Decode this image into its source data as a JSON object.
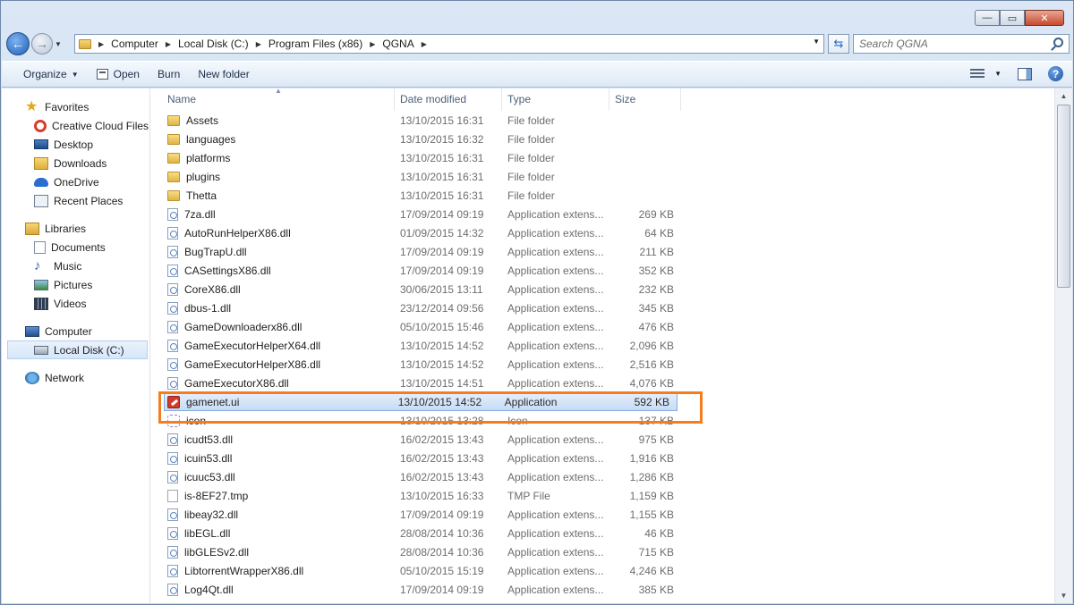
{
  "window": {
    "buttons": {
      "minimize": "—",
      "maximize": "▭",
      "close": "✕"
    }
  },
  "navigation": {
    "breadcrumb": [
      "Computer",
      "Local Disk (C:)",
      "Program Files (x86)",
      "QGNA"
    ],
    "search_placeholder": "Search QGNA"
  },
  "toolbar": {
    "organize": "Organize",
    "open": "Open",
    "burn": "Burn",
    "new_folder": "New folder"
  },
  "navpane": {
    "favorites": "Favorites",
    "creative_cloud": "Creative Cloud Files",
    "desktop": "Desktop",
    "downloads": "Downloads",
    "onedrive": "OneDrive",
    "recent": "Recent Places",
    "libraries": "Libraries",
    "documents": "Documents",
    "music": "Music",
    "pictures": "Pictures",
    "videos": "Videos",
    "computer": "Computer",
    "local_disk": "Local Disk (C:)",
    "network": "Network"
  },
  "columns": {
    "name": "Name",
    "date": "Date modified",
    "type": "Type",
    "size": "Size"
  },
  "files": [
    {
      "name": "Assets",
      "date": "13/10/2015 16:31",
      "type": "File folder",
      "size": "",
      "icon": "folder-icon"
    },
    {
      "name": "languages",
      "date": "13/10/2015 16:32",
      "type": "File folder",
      "size": "",
      "icon": "folder-icon"
    },
    {
      "name": "platforms",
      "date": "13/10/2015 16:31",
      "type": "File folder",
      "size": "",
      "icon": "folder-icon"
    },
    {
      "name": "plugins",
      "date": "13/10/2015 16:31",
      "type": "File folder",
      "size": "",
      "icon": "folder-icon"
    },
    {
      "name": "Thetta",
      "date": "13/10/2015 16:31",
      "type": "File folder",
      "size": "",
      "icon": "folder-icon"
    },
    {
      "name": "7za.dll",
      "date": "17/09/2014 09:19",
      "type": "Application extens...",
      "size": "269 KB",
      "icon": "dll-icon"
    },
    {
      "name": "AutoRunHelperX86.dll",
      "date": "01/09/2015 14:32",
      "type": "Application extens...",
      "size": "64 KB",
      "icon": "dll-icon"
    },
    {
      "name": "BugTrapU.dll",
      "date": "17/09/2014 09:19",
      "type": "Application extens...",
      "size": "211 KB",
      "icon": "dll-icon"
    },
    {
      "name": "CASettingsX86.dll",
      "date": "17/09/2014 09:19",
      "type": "Application extens...",
      "size": "352 KB",
      "icon": "dll-icon"
    },
    {
      "name": "CoreX86.dll",
      "date": "30/06/2015 13:11",
      "type": "Application extens...",
      "size": "232 KB",
      "icon": "dll-icon"
    },
    {
      "name": "dbus-1.dll",
      "date": "23/12/2014 09:56",
      "type": "Application extens...",
      "size": "345 KB",
      "icon": "dll-icon"
    },
    {
      "name": "GameDownloaderx86.dll",
      "date": "05/10/2015 15:46",
      "type": "Application extens...",
      "size": "476 KB",
      "icon": "dll-icon"
    },
    {
      "name": "GameExecutorHelperX64.dll",
      "date": "13/10/2015 14:52",
      "type": "Application extens...",
      "size": "2,096 KB",
      "icon": "dll-icon"
    },
    {
      "name": "GameExecutorHelperX86.dll",
      "date": "13/10/2015 14:52",
      "type": "Application extens...",
      "size": "2,516 KB",
      "icon": "dll-icon"
    },
    {
      "name": "GameExecutorX86.dll",
      "date": "13/10/2015 14:51",
      "type": "Application extens...",
      "size": "4,076 KB",
      "icon": "dll-icon"
    },
    {
      "name": "gamenet.ui",
      "date": "13/10/2015 14:52",
      "type": "Application",
      "size": "592 KB",
      "icon": "app-icon",
      "selected": true
    },
    {
      "name": "icon",
      "date": "13/10/2015 13:28",
      "type": "Icon",
      "size": "137 KB",
      "icon": "icon-file-icon"
    },
    {
      "name": "icudt53.dll",
      "date": "16/02/2015 13:43",
      "type": "Application extens...",
      "size": "975 KB",
      "icon": "dll-icon"
    },
    {
      "name": "icuin53.dll",
      "date": "16/02/2015 13:43",
      "type": "Application extens...",
      "size": "1,916 KB",
      "icon": "dll-icon"
    },
    {
      "name": "icuuc53.dll",
      "date": "16/02/2015 13:43",
      "type": "Application extens...",
      "size": "1,286 KB",
      "icon": "dll-icon"
    },
    {
      "name": "is-8EF27.tmp",
      "date": "13/10/2015 16:33",
      "type": "TMP File",
      "size": "1,159 KB",
      "icon": "tmp-file-icon"
    },
    {
      "name": "libeay32.dll",
      "date": "17/09/2014 09:19",
      "type": "Application extens...",
      "size": "1,155 KB",
      "icon": "dll-icon"
    },
    {
      "name": "libEGL.dll",
      "date": "28/08/2014 10:36",
      "type": "Application extens...",
      "size": "46 KB",
      "icon": "dll-icon"
    },
    {
      "name": "libGLESv2.dll",
      "date": "28/08/2014 10:36",
      "type": "Application extens...",
      "size": "715 KB",
      "icon": "dll-icon"
    },
    {
      "name": "LibtorrentWrapperX86.dll",
      "date": "05/10/2015 15:19",
      "type": "Application extens...",
      "size": "4,246 KB",
      "icon": "dll-icon"
    },
    {
      "name": "Log4Qt.dll",
      "date": "17/09/2014 09:19",
      "type": "Application extens...",
      "size": "385 KB",
      "icon": "dll-icon"
    }
  ],
  "colors": {
    "highlight": "#f47d20",
    "selection": "#c7dcf6"
  }
}
